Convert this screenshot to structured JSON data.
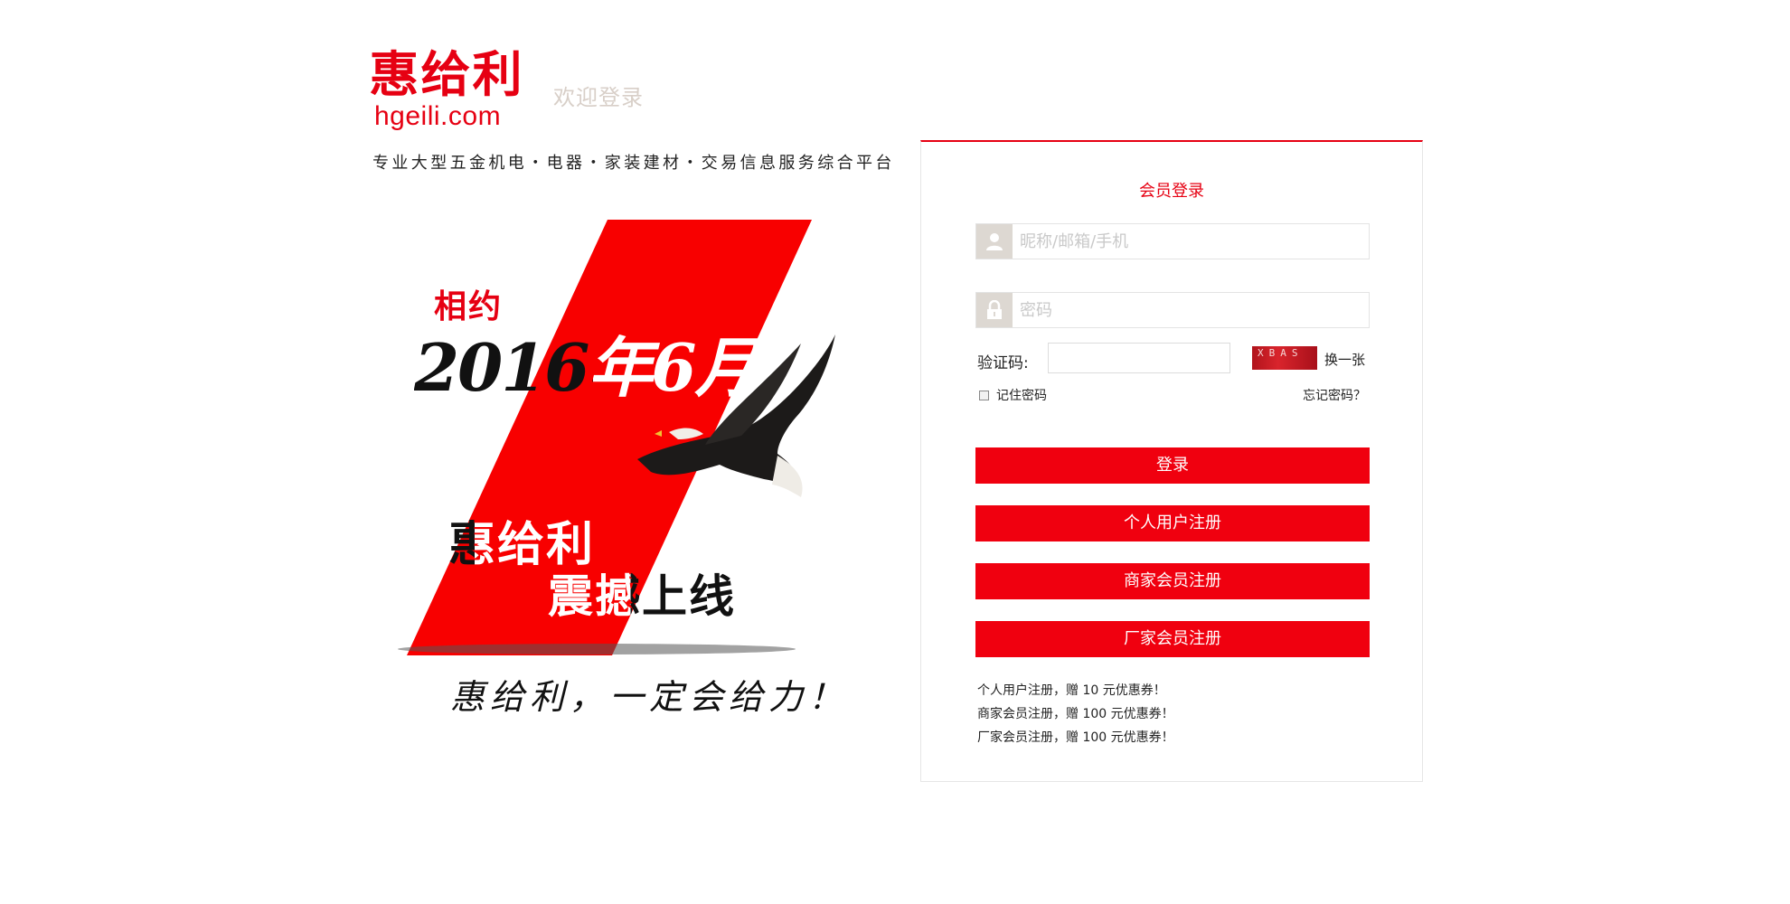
{
  "header": {
    "logo_cn": "惠给利",
    "logo_en": "hgeili.com",
    "welcome": "欢迎登录",
    "slogan": "专业大型五金机电・电器・家装建材・交易信息服务综合平台"
  },
  "banner": {
    "line1": "相约",
    "date": "2016年6月",
    "brand": "惠给利",
    "tagline": "震撼上线",
    "motto": "惠给利，一定会给力！",
    "accent_color": "#e60012"
  },
  "login": {
    "title": "会员登录",
    "username_placeholder": "昵称/邮箱/手机",
    "password_placeholder": "密码",
    "captcha_label": "验证码:",
    "captcha_image_text": "XBAS",
    "captcha_refresh": "换一张",
    "remember_label": "记住密码",
    "forgot_label": "忘记密码？",
    "login_button": "登录",
    "register_personal": "个人用户注册",
    "register_merchant": "商家会员注册",
    "register_factory": "厂家会员注册",
    "notes": [
      "个人用户注册，赠 10 元优惠券！",
      "商家会员注册，赠 100 元优惠券！",
      "厂家会员注册，赠 100 元优惠券！"
    ],
    "icons": {
      "user": "user-icon",
      "password": "lock-icon"
    },
    "button_color": "#f0000f"
  }
}
